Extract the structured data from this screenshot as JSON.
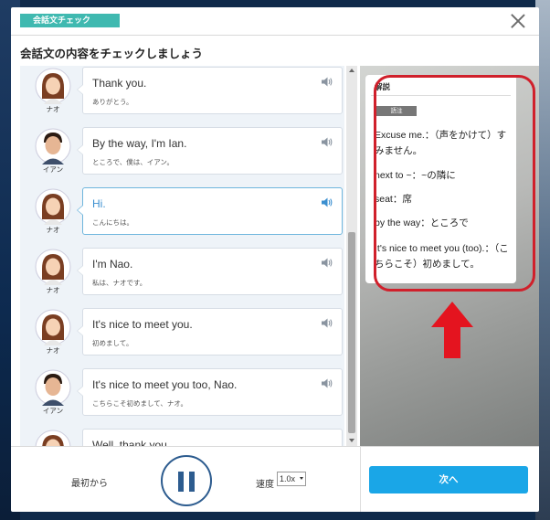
{
  "header": {
    "tag": "会話文チェック",
    "title": "会話文の内容をチェックしましょう"
  },
  "conversation": [
    {
      "speaker": "ナオ",
      "en": "Thank you.",
      "jp": "ありがとう。",
      "active": false
    },
    {
      "speaker": "イアン",
      "en": "By the way, I'm Ian.",
      "jp": "ところで、僕は、イアン。",
      "active": false
    },
    {
      "speaker": "ナオ",
      "en": "Hi.",
      "jp": "こんにちは。",
      "active": true
    },
    {
      "speaker": "ナオ",
      "en": "I'm Nao.",
      "jp": "私は、ナオです。",
      "active": false
    },
    {
      "speaker": "ナオ",
      "en": "It's nice to meet you.",
      "jp": "初めまして。",
      "active": false
    },
    {
      "speaker": "イアン",
      "en": "It's nice to meet you too, Nao.",
      "jp": "こちらこそ初めまして、ナオ。",
      "active": false
    },
    {
      "speaker": "ナオ",
      "en": "Well, thank you.",
      "jp": "",
      "active": false
    }
  ],
  "explanation": {
    "title": "解説",
    "badge": "語注",
    "notes": [
      "Excuse me.：（声をかけて）すみません。",
      "next to ~：~の隣に",
      "seat：席",
      "by the way：ところで",
      "It's nice to meet you (too).：（こちらこそ）初めまして。"
    ]
  },
  "controls": {
    "from_start": "最初から",
    "speed_label": "速度",
    "speed_value": "1.0x",
    "next": "次へ"
  },
  "colors": {
    "accent": "#1aa6e7",
    "tag": "#3fb9b0",
    "highlight": "#d0202b",
    "pause": "#2d5c8f"
  }
}
